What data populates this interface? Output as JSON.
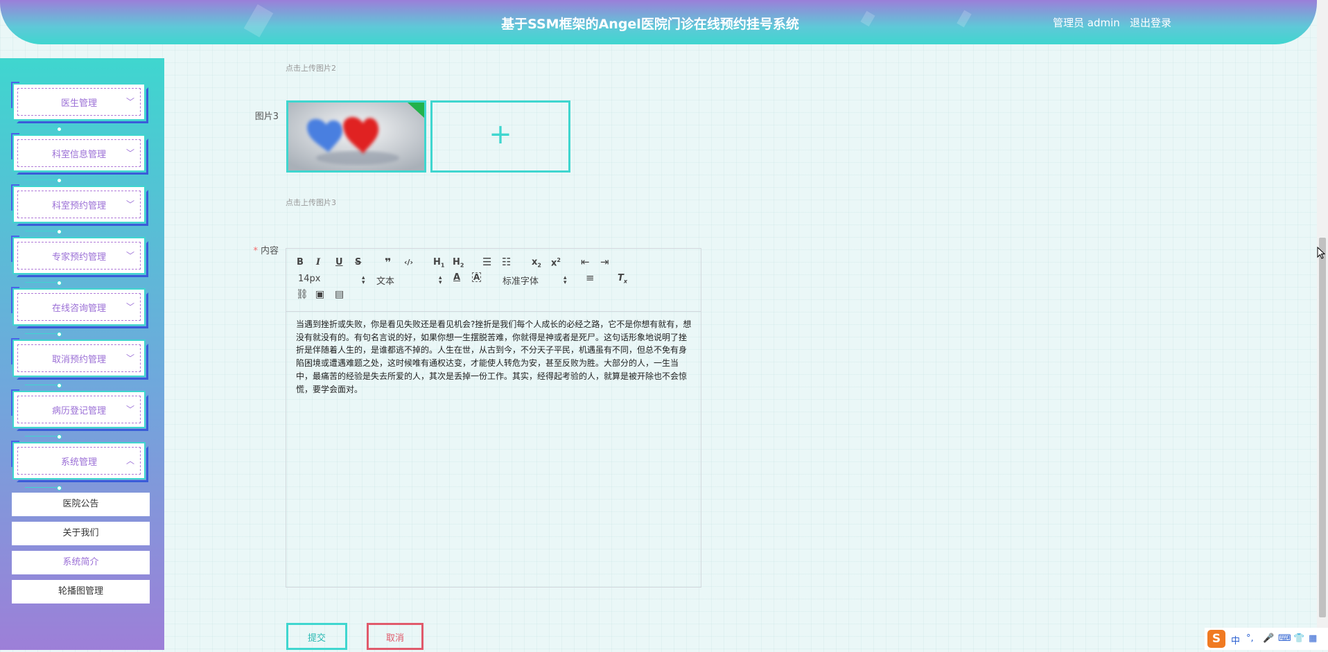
{
  "header": {
    "title": "基于SSM框架的Angel医院门诊在线预约挂号系统",
    "user": "管理员 admin",
    "logout": "退出登录"
  },
  "sidebar": {
    "menus": [
      {
        "label": "医生管理",
        "expanded": false
      },
      {
        "label": "科室信息管理",
        "expanded": false
      },
      {
        "label": "科室预约管理",
        "expanded": false
      },
      {
        "label": "专家预约管理",
        "expanded": false
      },
      {
        "label": "在线咨询管理",
        "expanded": false
      },
      {
        "label": "取消预约管理",
        "expanded": false
      },
      {
        "label": "病历登记管理",
        "expanded": false
      },
      {
        "label": "系统管理",
        "expanded": true
      }
    ],
    "submenus": [
      {
        "label": "医院公告"
      },
      {
        "label": "关于我们"
      },
      {
        "label": "系统简介",
        "active": true
      },
      {
        "label": "轮播图管理"
      }
    ]
  },
  "form": {
    "hint_image2": "点击上传图片2",
    "image3_label": "图片3",
    "hint_image3": "点击上传图片3",
    "content_label": "内容",
    "content_required_mark": "*",
    "editor": {
      "font_size": "14px",
      "paragraph": "文本",
      "font_family": "标准字体",
      "text": "当遇到挫折或失败，你是看见失败还是看见机会?挫折是我们每个人成长的必经之路，它不是你想有就有，想没有就没有的。有句名言说的好，如果你想一生摆脱苦难，你就得是神或者是死尸。这句话形象地说明了挫折是伴随着人生的，是谁都逃不掉的。人生在世，从古到今，不分天子平民，机遇虽有不同，但总不免有身陷困境或遭遇难题之处，这时候唯有通权达变，才能使人转危为安，甚至反败为胜。大部分的人，一生当中，最痛苦的经验是失去所爱的人，其次是丢掉一份工作。其实，经得起考验的人，就算是被开除也不会惊慌，要学会面对。"
    },
    "submit": "提交",
    "cancel": "取消"
  },
  "ime": {
    "logo": "S",
    "lang": "中",
    "punct": "°,"
  },
  "colors": {
    "accent": "#3fd6cf",
    "purple": "#9b6fd6",
    "danger": "#e05a6b"
  }
}
